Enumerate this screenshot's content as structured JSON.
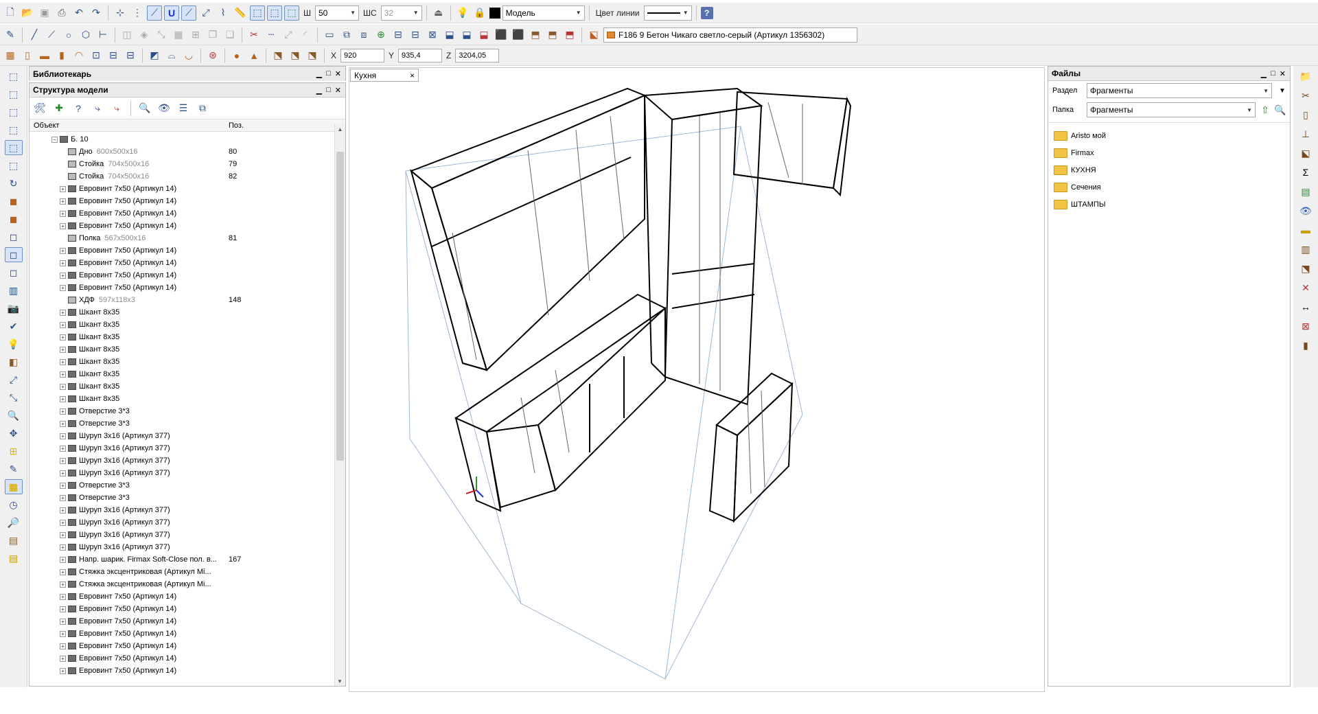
{
  "toolbar1": {
    "width_label": "Ш",
    "width_value": "50",
    "shs_label": "ШС",
    "shs_value": "32",
    "layer_value": "Модель",
    "line_color_label": "Цвет линии",
    "help_label": "?"
  },
  "toolbar2": {
    "material_label": "F186 9 Бетон Чикаго светло-серый (Артикул 1356302)"
  },
  "toolbar3": {
    "x_label": "X",
    "x_value": "920",
    "y_label": "Y",
    "y_value": "935,4",
    "z_label": "Z",
    "z_value": "3204,05"
  },
  "library": {
    "title": "Библиотекарь"
  },
  "structure": {
    "title": "Структура модели",
    "col_object": "Объект",
    "col_pos": "Поз.",
    "root": "Б. 10",
    "rows": [
      {
        "name": "Дно",
        "dim": "600x500x16",
        "pos": "80",
        "exp": false
      },
      {
        "name": "Стойка",
        "dim": "704x500x16",
        "pos": "79",
        "exp": false
      },
      {
        "name": "Стойка",
        "dim": "704x500x16",
        "pos": "82",
        "exp": false
      },
      {
        "name": "Евровинт 7x50 (Артикул 14)",
        "dim": "",
        "pos": "",
        "exp": true
      },
      {
        "name": "Евровинт 7x50 (Артикул 14)",
        "dim": "",
        "pos": "",
        "exp": true
      },
      {
        "name": "Евровинт 7x50 (Артикул 14)",
        "dim": "",
        "pos": "",
        "exp": true
      },
      {
        "name": "Евровинт 7x50 (Артикул 14)",
        "dim": "",
        "pos": "",
        "exp": true
      },
      {
        "name": "Полка",
        "dim": "567x500x16",
        "pos": "81",
        "exp": false
      },
      {
        "name": "Евровинт 7x50 (Артикул 14)",
        "dim": "",
        "pos": "",
        "exp": true
      },
      {
        "name": "Евровинт 7x50 (Артикул 14)",
        "dim": "",
        "pos": "",
        "exp": true
      },
      {
        "name": "Евровинт 7x50 (Артикул 14)",
        "dim": "",
        "pos": "",
        "exp": true
      },
      {
        "name": "Евровинт 7x50 (Артикул 14)",
        "dim": "",
        "pos": "",
        "exp": true
      },
      {
        "name": "ХДФ",
        "dim": "597x118x3",
        "pos": "148",
        "exp": false
      },
      {
        "name": "Шкант 8x35",
        "dim": "",
        "pos": "",
        "exp": true
      },
      {
        "name": "Шкант 8x35",
        "dim": "",
        "pos": "",
        "exp": true
      },
      {
        "name": "Шкант 8x35",
        "dim": "",
        "pos": "",
        "exp": true
      },
      {
        "name": "Шкант 8x35",
        "dim": "",
        "pos": "",
        "exp": true
      },
      {
        "name": "Шкант 8x35",
        "dim": "",
        "pos": "",
        "exp": true
      },
      {
        "name": "Шкант 8x35",
        "dim": "",
        "pos": "",
        "exp": true
      },
      {
        "name": "Шкант 8x35",
        "dim": "",
        "pos": "",
        "exp": true
      },
      {
        "name": "Шкант 8x35",
        "dim": "",
        "pos": "",
        "exp": true
      },
      {
        "name": "Отверстие 3*3",
        "dim": "",
        "pos": "",
        "exp": true
      },
      {
        "name": "Отверстие 3*3",
        "dim": "",
        "pos": "",
        "exp": true
      },
      {
        "name": "Шуруп 3x16 (Артикул 377)",
        "dim": "",
        "pos": "",
        "exp": true
      },
      {
        "name": "Шуруп 3x16 (Артикул 377)",
        "dim": "",
        "pos": "",
        "exp": true
      },
      {
        "name": "Шуруп 3x16 (Артикул 377)",
        "dim": "",
        "pos": "",
        "exp": true
      },
      {
        "name": "Шуруп 3x16 (Артикул 377)",
        "dim": "",
        "pos": "",
        "exp": true
      },
      {
        "name": "Отверстие 3*3",
        "dim": "",
        "pos": "",
        "exp": true
      },
      {
        "name": "Отверстие 3*3",
        "dim": "",
        "pos": "",
        "exp": true
      },
      {
        "name": "Шуруп 3x16 (Артикул 377)",
        "dim": "",
        "pos": "",
        "exp": true
      },
      {
        "name": "Шуруп 3x16 (Артикул 377)",
        "dim": "",
        "pos": "",
        "exp": true
      },
      {
        "name": "Шуруп 3x16 (Артикул 377)",
        "dim": "",
        "pos": "",
        "exp": true
      },
      {
        "name": "Шуруп 3x16 (Артикул 377)",
        "dim": "",
        "pos": "",
        "exp": true
      },
      {
        "name": "Напр. шарик. Firmax Soft-Close пол. в...",
        "dim": "",
        "pos": "167",
        "exp": true
      },
      {
        "name": "Стяжка эксцентриковая (Артикул Mi...",
        "dim": "",
        "pos": "",
        "exp": true
      },
      {
        "name": "Стяжка эксцентриковая (Артикул Mi...",
        "dim": "",
        "pos": "",
        "exp": true
      },
      {
        "name": "Евровинт 7x50 (Артикул 14)",
        "dim": "",
        "pos": "",
        "exp": true
      },
      {
        "name": "Евровинт 7x50 (Артикул 14)",
        "dim": "",
        "pos": "",
        "exp": true
      },
      {
        "name": "Евровинт 7x50 (Артикул 14)",
        "dim": "",
        "pos": "",
        "exp": true
      },
      {
        "name": "Евровинт 7x50 (Артикул 14)",
        "dim": "",
        "pos": "",
        "exp": true
      },
      {
        "name": "Евровинт 7x50 (Артикул 14)",
        "dim": "",
        "pos": "",
        "exp": true
      },
      {
        "name": "Евровинт 7x50 (Артикул 14)",
        "dim": "",
        "pos": "",
        "exp": true
      },
      {
        "name": "Евровинт 7x50 (Артикул 14)",
        "dim": "",
        "pos": "",
        "exp": true
      }
    ]
  },
  "viewport": {
    "tab_label": "Кухня",
    "close": "×"
  },
  "files": {
    "title": "Файлы",
    "section_label": "Раздел",
    "section_value": "Фрагменты",
    "folder_label": "Папка",
    "folder_value": "Фрагменты",
    "folders": [
      "Aristo мой",
      "Firmax",
      "КУХНЯ",
      "Сечения",
      "ШТАМПЫ"
    ]
  }
}
